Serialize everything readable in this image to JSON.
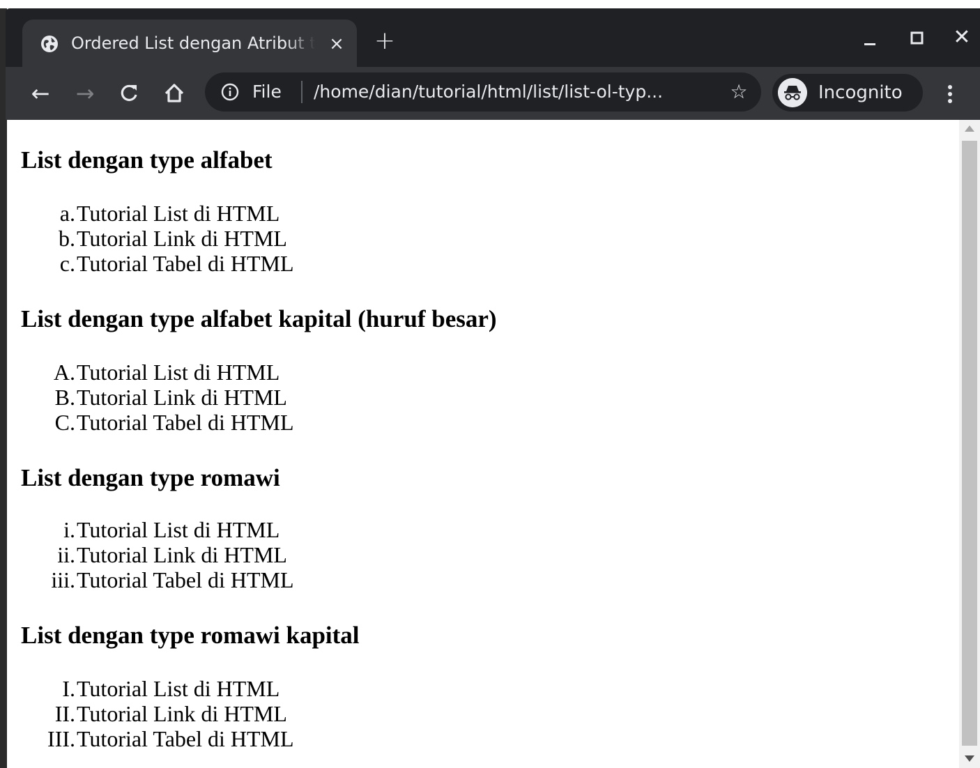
{
  "tab": {
    "title": "Ordered List dengan Atribut type",
    "close_glyph": "×"
  },
  "new_tab_glyph": "+",
  "window_controls": {
    "close_glyph": "✕"
  },
  "toolbar": {
    "back_glyph": "←",
    "forward_glyph": "→",
    "reload_glyph": "C",
    "home_glyph": "⌂"
  },
  "omnibox": {
    "file_label": "File",
    "url": "/home/dian/tutorial/html/list/list-ol-typ...",
    "star_glyph": "☆"
  },
  "incognito": {
    "label": "Incognito"
  },
  "sections": [
    {
      "heading": "List dengan type alfabet",
      "items": [
        {
          "marker": "a.",
          "text": "Tutorial List di HTML"
        },
        {
          "marker": "b.",
          "text": "Tutorial Link di HTML"
        },
        {
          "marker": "c.",
          "text": "Tutorial Tabel di HTML"
        }
      ]
    },
    {
      "heading": "List dengan type alfabet kapital (huruf besar)",
      "items": [
        {
          "marker": "A.",
          "text": "Tutorial List di HTML"
        },
        {
          "marker": "B.",
          "text": "Tutorial Link di HTML"
        },
        {
          "marker": "C.",
          "text": "Tutorial Tabel di HTML"
        }
      ]
    },
    {
      "heading": "List dengan type romawi",
      "items": [
        {
          "marker": "i.",
          "text": "Tutorial List di HTML"
        },
        {
          "marker": "ii.",
          "text": "Tutorial Link di HTML"
        },
        {
          "marker": "iii.",
          "text": "Tutorial Tabel di HTML"
        }
      ]
    },
    {
      "heading": "List dengan type romawi kapital",
      "items": [
        {
          "marker": "I.",
          "text": "Tutorial List di HTML"
        },
        {
          "marker": "II.",
          "text": "Tutorial Link di HTML"
        },
        {
          "marker": "III.",
          "text": "Tutorial Tabel di HTML"
        }
      ]
    }
  ]
}
